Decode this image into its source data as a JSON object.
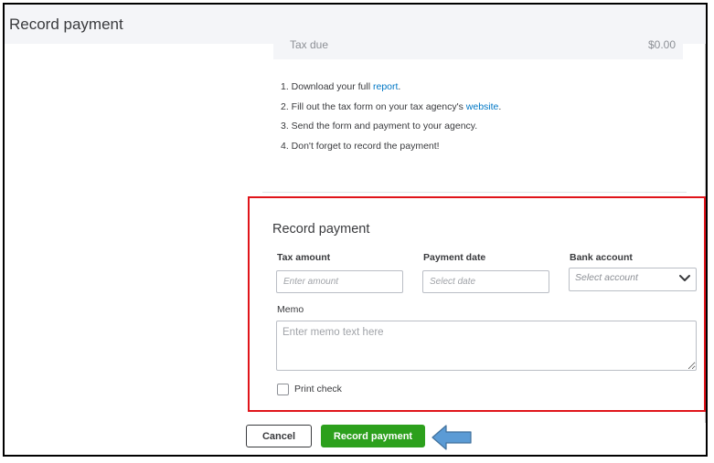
{
  "window": {
    "title": "Record payment"
  },
  "summary": {
    "label": "Tax due",
    "amount": "$0.00"
  },
  "steps": [
    {
      "prefix": "1. Download your full ",
      "link": "report",
      "suffix": "."
    },
    {
      "prefix": "2. Fill out the tax form on your tax agency's ",
      "link": "website",
      "suffix": "."
    },
    {
      "prefix": "3. Send the form and payment to your agency.",
      "link": "",
      "suffix": ""
    },
    {
      "prefix": "4. Don't forget to record the payment!",
      "link": "",
      "suffix": ""
    }
  ],
  "form": {
    "title": "Record payment",
    "tax_amount": {
      "label": "Tax amount",
      "placeholder": "Enter amount"
    },
    "payment_date": {
      "label": "Payment date",
      "placeholder": "Select date"
    },
    "bank_account": {
      "label": "Bank account",
      "placeholder": "Select account"
    },
    "memo": {
      "label": "Memo",
      "placeholder": "Enter memo text here"
    },
    "print_check": {
      "label": "Print check",
      "checked": false
    }
  },
  "actions": {
    "cancel_label": "Cancel",
    "record_label": "Record payment"
  },
  "colors": {
    "primary_green": "#2ca01c",
    "link_blue": "#0077c5",
    "highlight_red": "#e0141a",
    "annotation_arrow": "#5b9bd5"
  },
  "icons": {
    "dropdown": "chevron-down-icon",
    "annotation": "arrow-left-icon"
  }
}
